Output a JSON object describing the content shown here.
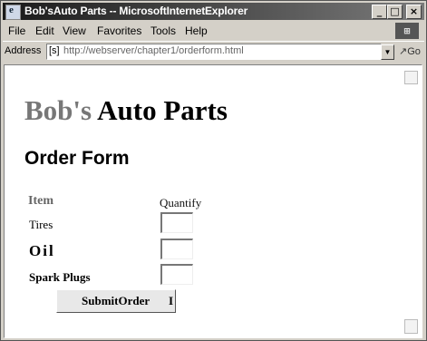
{
  "window": {
    "title": "Bob'sAuto Parts -- MicrosoftInternetExplorer",
    "buttons": [
      "_",
      "□",
      "×"
    ]
  },
  "menu": {
    "items": [
      "File",
      "Edit",
      "View",
      "Favorites",
      "Tools",
      "Help"
    ]
  },
  "address": {
    "label": "Address",
    "favicon": "[s]",
    "url": "http://webserver/chapter1/orderform.html",
    "go_label": "Go"
  },
  "page": {
    "heading_part1": "Bob's",
    "heading_part2": "Auto Parts",
    "subheading": "Order Form",
    "columns": [
      "Item",
      "Quantify"
    ],
    "items": [
      "Tires",
      "Oil",
      "Spark Plugs"
    ],
    "submit_label": "SubmitOrder",
    "submit_trailing": "I"
  },
  "colors": {
    "heading_gray": "#777777",
    "title_bar": "#1a1a1a"
  }
}
